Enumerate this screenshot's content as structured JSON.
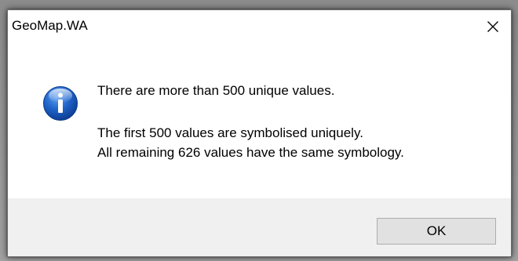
{
  "window": {
    "title": "GeoMap.WA",
    "close_icon": "close-icon"
  },
  "message": {
    "icon": "info-icon",
    "line1": "There are more than 500 unique values.",
    "line2": "The first 500 values are symbolised uniquely.",
    "line3": "All remaining 626 values have the same symbology."
  },
  "buttons": {
    "ok_label": "OK"
  },
  "colors": {
    "icon_blue": "#1c5fc7",
    "footer_bg": "#f0f0f0",
    "button_bg": "#e1e1e1"
  }
}
